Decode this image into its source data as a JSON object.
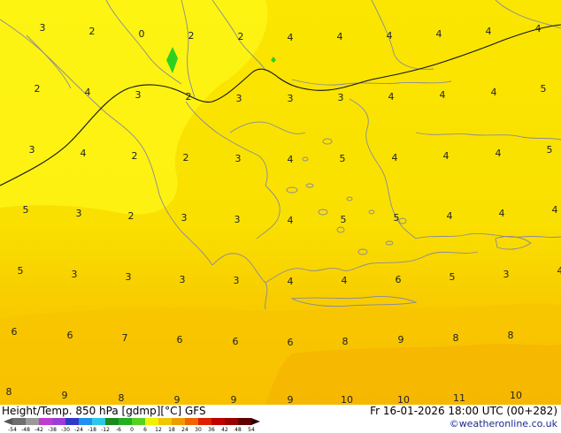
{
  "footer": {
    "left_label": "Height/Temp. 850 hPa [gdmp][°C] GFS",
    "right_label": "Fr 16-01-2026 18:00 UTC (00+282)",
    "credit": "©weatheronline.co.uk"
  },
  "colorbar": {
    "ticks": [
      "-54",
      "-48",
      "-42",
      "-38",
      "-30",
      "-24",
      "-18",
      "-12",
      "-6",
      "0",
      "6",
      "12",
      "18",
      "24",
      "30",
      "36",
      "42",
      "48",
      "54"
    ],
    "colors": [
      "#6e6e6e",
      "#9a9a9a",
      "#c03cd0",
      "#9a3cd8",
      "#2f38c8",
      "#1f8ff0",
      "#2ac8e8",
      "#1e8a1e",
      "#20b020",
      "#58d020",
      "#f0f000",
      "#f0c800",
      "#f09c00",
      "#f06400",
      "#e01e00",
      "#c00000",
      "#9a0000",
      "#600000"
    ]
  },
  "contour_labels": [
    {
      "t": "3"
    },
    {
      "t": "2"
    },
    {
      "t": "0"
    },
    {
      "t": "2"
    },
    {
      "t": "2"
    },
    {
      "t": "4"
    },
    {
      "t": "4"
    },
    {
      "t": "4"
    },
    {
      "t": "4"
    },
    {
      "t": "4"
    },
    {
      "t": "4"
    },
    {
      "t": "2"
    },
    {
      "t": "4"
    },
    {
      "t": "3"
    },
    {
      "t": "2"
    },
    {
      "t": "3"
    },
    {
      "t": "3"
    },
    {
      "t": "3"
    },
    {
      "t": "4"
    },
    {
      "t": "4"
    },
    {
      "t": "4"
    },
    {
      "t": "5"
    },
    {
      "t": "3"
    },
    {
      "t": "4"
    },
    {
      "t": "2"
    },
    {
      "t": "2"
    },
    {
      "t": "3"
    },
    {
      "t": "4"
    },
    {
      "t": "5"
    },
    {
      "t": "4"
    },
    {
      "t": "4"
    },
    {
      "t": "4"
    },
    {
      "t": "5"
    },
    {
      "t": "5"
    },
    {
      "t": "3"
    },
    {
      "t": "2"
    },
    {
      "t": "3"
    },
    {
      "t": "3"
    },
    {
      "t": "4"
    },
    {
      "t": "5"
    },
    {
      "t": "5"
    },
    {
      "t": "4"
    },
    {
      "t": "4"
    },
    {
      "t": "4"
    },
    {
      "t": "5"
    },
    {
      "t": "3"
    },
    {
      "t": "3"
    },
    {
      "t": "3"
    },
    {
      "t": "3"
    },
    {
      "t": "4"
    },
    {
      "t": "4"
    },
    {
      "t": "6"
    },
    {
      "t": "5"
    },
    {
      "t": "3"
    },
    {
      "t": "4"
    },
    {
      "t": "6"
    },
    {
      "t": "6"
    },
    {
      "t": "7"
    },
    {
      "t": "6"
    },
    {
      "t": "6"
    },
    {
      "t": "6"
    },
    {
      "t": "8"
    },
    {
      "t": "9"
    },
    {
      "t": "8"
    },
    {
      "t": "8"
    },
    {
      "t": "8"
    },
    {
      "t": "9"
    },
    {
      "t": "8"
    },
    {
      "t": "9"
    },
    {
      "t": "9"
    },
    {
      "t": "9"
    },
    {
      "t": "10"
    },
    {
      "t": "10"
    },
    {
      "t": "11"
    },
    {
      "t": "10"
    }
  ]
}
